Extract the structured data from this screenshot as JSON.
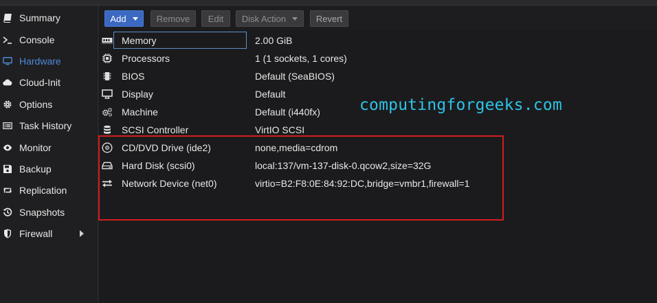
{
  "sidebar": {
    "items": [
      {
        "label": "Summary",
        "icon": "book-icon"
      },
      {
        "label": "Console",
        "icon": "terminal-icon"
      },
      {
        "label": "Hardware",
        "icon": "monitor-icon",
        "active": true
      },
      {
        "label": "Cloud-Init",
        "icon": "cloud-icon"
      },
      {
        "label": "Options",
        "icon": "gear-icon"
      },
      {
        "label": "Task History",
        "icon": "list-icon"
      },
      {
        "label": "Monitor",
        "icon": "eye-icon"
      },
      {
        "label": "Backup",
        "icon": "floppy-icon"
      },
      {
        "label": "Replication",
        "icon": "retweet-icon"
      },
      {
        "label": "Snapshots",
        "icon": "history-icon"
      },
      {
        "label": "Firewall",
        "icon": "shield-icon",
        "has_submenu": true
      }
    ],
    "active_color": "#4d8ad8"
  },
  "toolbar": {
    "add_label": "Add",
    "remove_label": "Remove",
    "edit_label": "Edit",
    "disk_action_label": "Disk Action",
    "revert_label": "Revert",
    "accent": "#3b69c2"
  },
  "hardware": {
    "rows": [
      {
        "name": "Memory",
        "value": "2.00 GiB",
        "icon": "memory-icon",
        "selected": true
      },
      {
        "name": "Processors",
        "value": "1 (1 sockets, 1 cores)",
        "icon": "cpu-icon"
      },
      {
        "name": "BIOS",
        "value": "Default (SeaBIOS)",
        "icon": "chip-icon"
      },
      {
        "name": "Display",
        "value": "Default",
        "icon": "desktop-icon"
      },
      {
        "name": "Machine",
        "value": "Default (i440fx)",
        "icon": "cogs-icon"
      },
      {
        "name": "SCSI Controller",
        "value": "VirtIO SCSI",
        "icon": "database-icon"
      },
      {
        "name": "CD/DVD Drive (ide2)",
        "value": "none,media=cdrom",
        "icon": "cdrom-icon"
      },
      {
        "name": "Hard Disk (scsi0)",
        "value": "local:137/vm-137-disk-0.qcow2,size=32G",
        "icon": "hdd-icon"
      },
      {
        "name": "Network Device (net0)",
        "value": "virtio=B2:F8:0E:84:92:DC,bridge=vmbr1,firewall=1",
        "icon": "exchange-icon"
      }
    ]
  },
  "watermark": {
    "text": "computingforgeeks.com",
    "color": "#2ec3e6"
  },
  "highlight_color": "#d41e1e"
}
